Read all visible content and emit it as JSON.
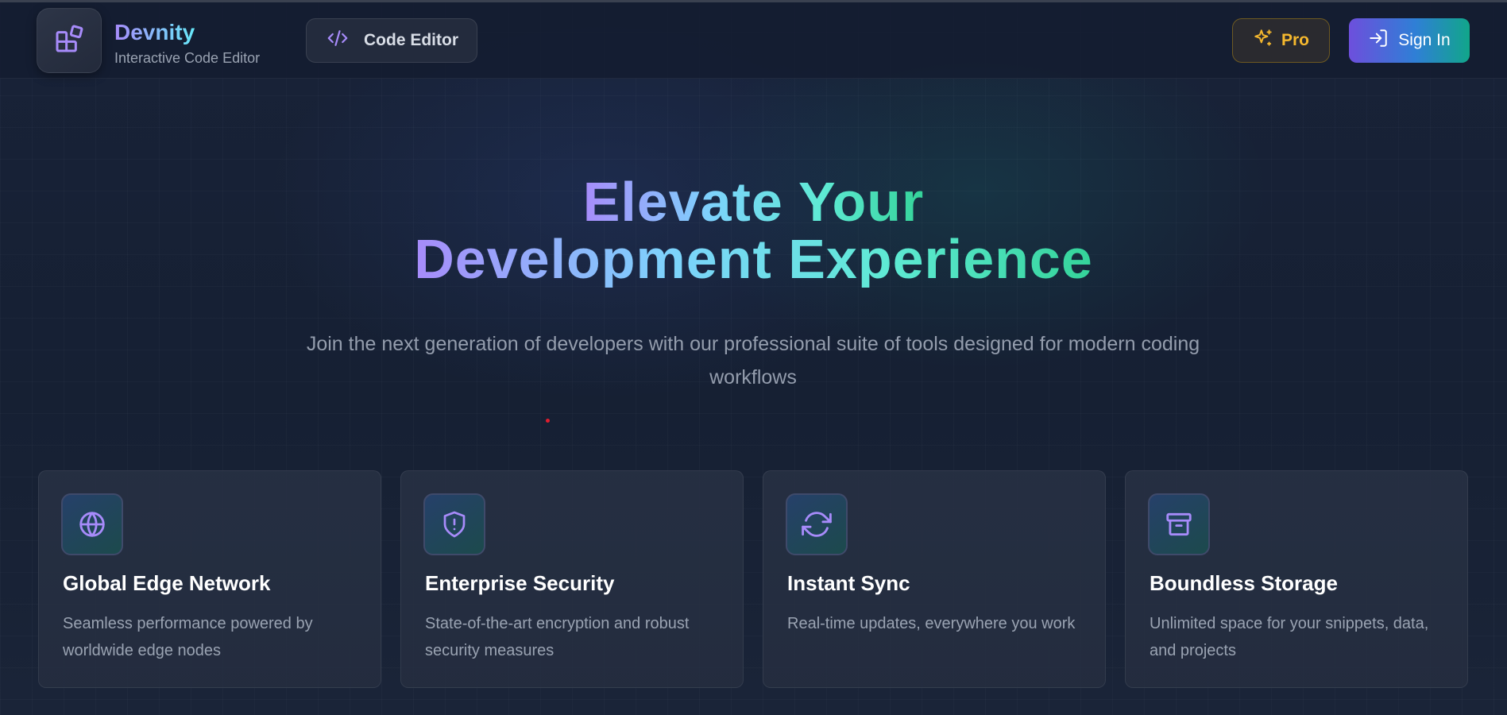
{
  "brand": {
    "name": "Devnity",
    "subtitle": "Interactive Code Editor",
    "logo_icon": "blocks-icon"
  },
  "nav": {
    "code_editor_label": "Code Editor",
    "code_editor_icon": "code-icon",
    "pro_label": "Pro",
    "pro_icon": "sparkles-icon",
    "signin_label": "Sign In",
    "signin_icon": "log-in-icon"
  },
  "hero": {
    "title_line1": "Elevate Your",
    "title_line2": "Development Experience",
    "subtitle": "Join the next generation of developers with our professional suite of tools designed for modern coding workflows"
  },
  "features": [
    {
      "icon": "globe-icon",
      "title": "Global Edge Network",
      "description": "Seamless performance powered by worldwide edge nodes"
    },
    {
      "icon": "shield-alert-icon",
      "title": "Enterprise Security",
      "description": "State-of-the-art encryption and robust security measures"
    },
    {
      "icon": "refresh-icon",
      "title": "Instant Sync",
      "description": "Real-time updates, everywhere you work"
    },
    {
      "icon": "archive-icon",
      "title": "Boundless Storage",
      "description": "Unlimited space for your snippets, data, and projects"
    }
  ],
  "colors": {
    "accent_purple": "#a78bfa",
    "accent_teal": "#34d399",
    "pro_gold": "#f5b82e",
    "background": "#162033"
  }
}
